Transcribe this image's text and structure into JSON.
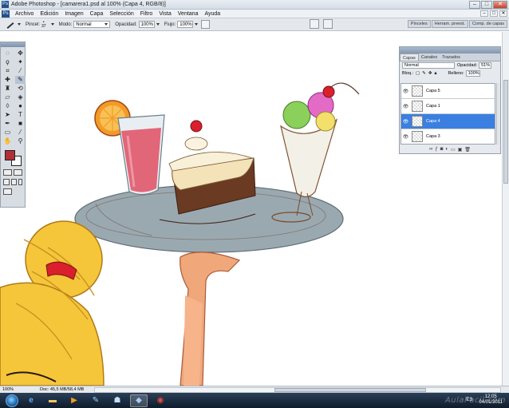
{
  "window": {
    "title": "Adobe Photoshop - [camarera1.psd al 100% (Capa 4, RGB/8)]"
  },
  "menubar": {
    "items": [
      "Archivo",
      "Edición",
      "Imagen",
      "Capa",
      "Selección",
      "Filtro",
      "Vista",
      "Ventana",
      "Ayuda"
    ]
  },
  "options": {
    "brush_label": "Pincel:",
    "brush_size": "37",
    "mode_label": "Modo:",
    "mode_value": "Normal",
    "opacity_label": "Opacidad:",
    "opacity_value": "100%",
    "flow_label": "Flujo:",
    "flow_value": "100%"
  },
  "palette_well_tabs": [
    "Pinceles",
    "Herram. preest.",
    "Comp. de capas"
  ],
  "layers_panel": {
    "tabs": [
      "Capas",
      "Canales",
      "Trazados"
    ],
    "blend_mode": "Normal",
    "opacity_label": "Opacidad:",
    "opacity_value": "51%",
    "lock_label": "Bloq.:",
    "fill_label": "Relleno:",
    "fill_value": "100%",
    "layers": [
      {
        "name": "Capa 5",
        "selected": false
      },
      {
        "name": "Capa 1",
        "selected": false
      },
      {
        "name": "Capa 4",
        "selected": true
      },
      {
        "name": "Capa 3",
        "selected": false
      }
    ]
  },
  "tools": {
    "foreground_color": "#b03035",
    "background_color": "#ffffff"
  },
  "status": {
    "zoom": "100%",
    "doc": "Doc: 45,5 MB/58,4 MB"
  },
  "taskbar": {
    "language": "ES",
    "time": "12:05",
    "date": "04/01/2011",
    "watermark": "AulaFacil.com"
  },
  "colors": {
    "tray": "#9aa9b0",
    "hair": "#f5c63a",
    "skin": "#f0a77a",
    "drink": "#e0566a",
    "selected_layer": "#3b7fe0"
  }
}
